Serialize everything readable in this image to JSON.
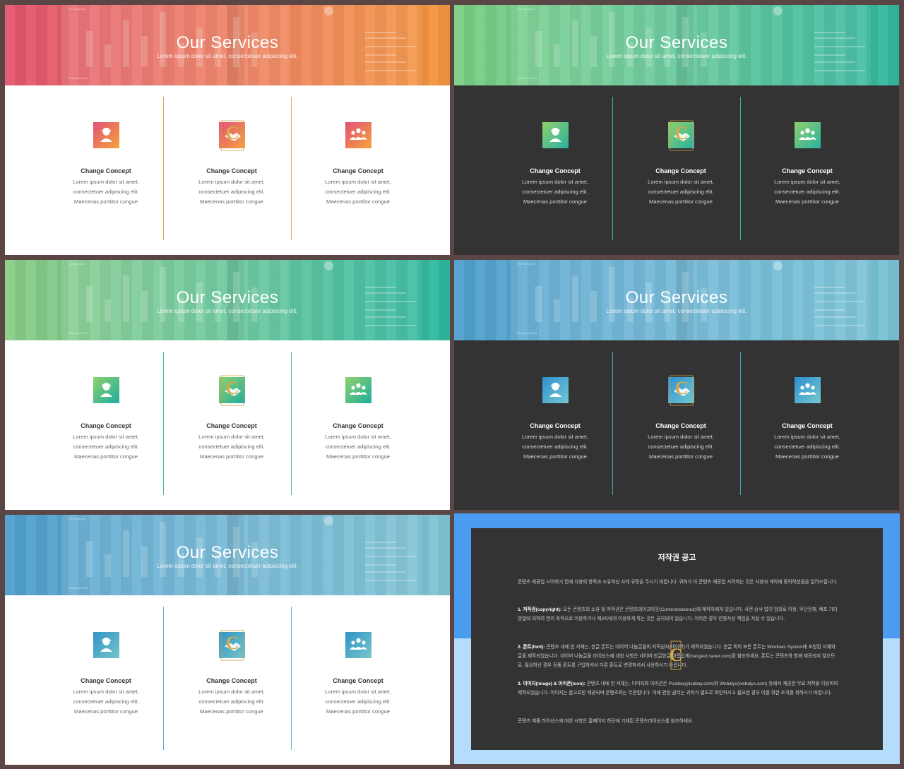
{
  "slides": [
    {
      "theme": "light",
      "grad": [
        "#e4546f",
        "#f4963e"
      ],
      "accent": "#e5a44f",
      "icon": [
        "#e3517a",
        "#f5a43b"
      ],
      "title": "Our Services",
      "subtitle": "Lorem ipsum dolor sit amet, consectetuer adipiscing elit."
    },
    {
      "theme": "dark",
      "grad": [
        "#7bcf83",
        "#34b8a0"
      ],
      "accent": "#3fb28c",
      "icon": [
        "#8fd06c",
        "#2bb1a0"
      ],
      "title": "Our Services",
      "subtitle": "Lorem ipsum dolor sit amet, consectetuer adipiscing elit."
    },
    {
      "theme": "light",
      "grad": [
        "#8ccd86",
        "#2db8a0"
      ],
      "accent": "#46b6a6",
      "icon": [
        "#8fd06c",
        "#1fae9f"
      ],
      "title": "Our Services",
      "subtitle": "Lorem ipsum dolor sit amet, consectetuer adipiscing elit."
    },
    {
      "theme": "dark",
      "grad": [
        "#4f9fce",
        "#79c3d6"
      ],
      "accent": "#4aa1b6",
      "icon": [
        "#2f8fd0",
        "#72c9cf"
      ],
      "title": "Our Services",
      "subtitle": "Lorem ipsum dolor sit amet, consectetuer adipiscing elit."
    },
    {
      "theme": "light",
      "grad": [
        "#4f9fce",
        "#7fc4d4"
      ],
      "accent": "#62b3c6",
      "icon": [
        "#3193c8",
        "#76c6c8"
      ],
      "title": "Our Services",
      "subtitle": "Lorem ipsum dolor sit amet, consectetuer adipiscing elit."
    }
  ],
  "columns": [
    {
      "title": "Change Concept",
      "lines": [
        "Lorem ipsum dolor sit amet,",
        "consectetuer adipiscing  elit.",
        "Maecenas porttitor congue"
      ],
      "icon": "person-icon"
    },
    {
      "title": "Change Concept",
      "lines": [
        "Lorem ipsum dolor sit amet,",
        "consectetuer adipiscing  elit.",
        "Maecenas porttitor congue"
      ],
      "icon": "handshake-icon"
    },
    {
      "title": "Change Concept",
      "lines": [
        "Lorem ipsum dolor sit amet,",
        "consectetuer adipiscing  elit.",
        "Maecenas porttitor congue"
      ],
      "icon": "group-icon"
    }
  ],
  "hero_mini": {
    "company": "Our company",
    "footer": "Business Name"
  },
  "copyright": {
    "title": "저작권 공고",
    "p1": "콘텐츠 제공업 시어하기 전에 사용의 항목과 소유하신 사제 규정을 주시기 바랍니다. 귀하가 이 콘텐츠 제공업 시어하는 것은 사용자 계약에 동의하셨음을 알려드립니다.",
    "p2_head": "1. 저작권(copyright):",
    "p2": "모든 콘텐츠의 소유 및 저작권은 콘텐츠테이크아웃(Contentstakeout)에 제작자에게 있습니다. 사전 승낙 없이 임의로 이용, 무단전재, 배포 기타 방법에 의하여 영리 목적으로 이용하거나 제3자에게 이용하게 하는 것은 금지되어 있습니다. 이러한 경우 민형사상 책임을 지실 수 있습니다.",
    "p3_head": "2. 폰트(font):",
    "p3": "콘텐츠 내에 한 서체는, 한글 폰트는 네이버 나눔글꼴의 저작권자(네이버)가 제작되었습니다. 한글 외의 보든 폰트는 Windows System에 포함된 서체와 글꼴 제작되었습니다. 네이버 나눔글꼴 라이선스에 대한 사항은 네이버 한글한글 아름답게(hangeul.naver.com)를 참조하세요. 폰트는 콘텐츠와 함께 제공되지 않으므로, 필요하신 경우 정품 폰트를 구입하셔서 다른 폰트로 변경하셔서 사용하시기 바랍니다.",
    "p4_head": "3. 이미지(image) & 아이콘(icon):",
    "p4": "콘텐츠 내에 한 서체는, 이미지와 아이콘은 Pixabay(pixabay.com)와 Webalys(webalys.com) 등에서 제공한 무료 저작물 이용하여 제작되었습니다. 이미지는 참고로만 제공되며 콘텐츠와는 무관합니다. 이에 관한 권리는 귀하가 별도로 확인하시고 필요한 경우 이를 위한 조치를 취하시기 바랍니다.",
    "p5": "콘텐츠 제품 라이선스에 대한 사항은 홈페이지 하단에 기재된 콘텐츠라이선스를 참조하세요."
  }
}
